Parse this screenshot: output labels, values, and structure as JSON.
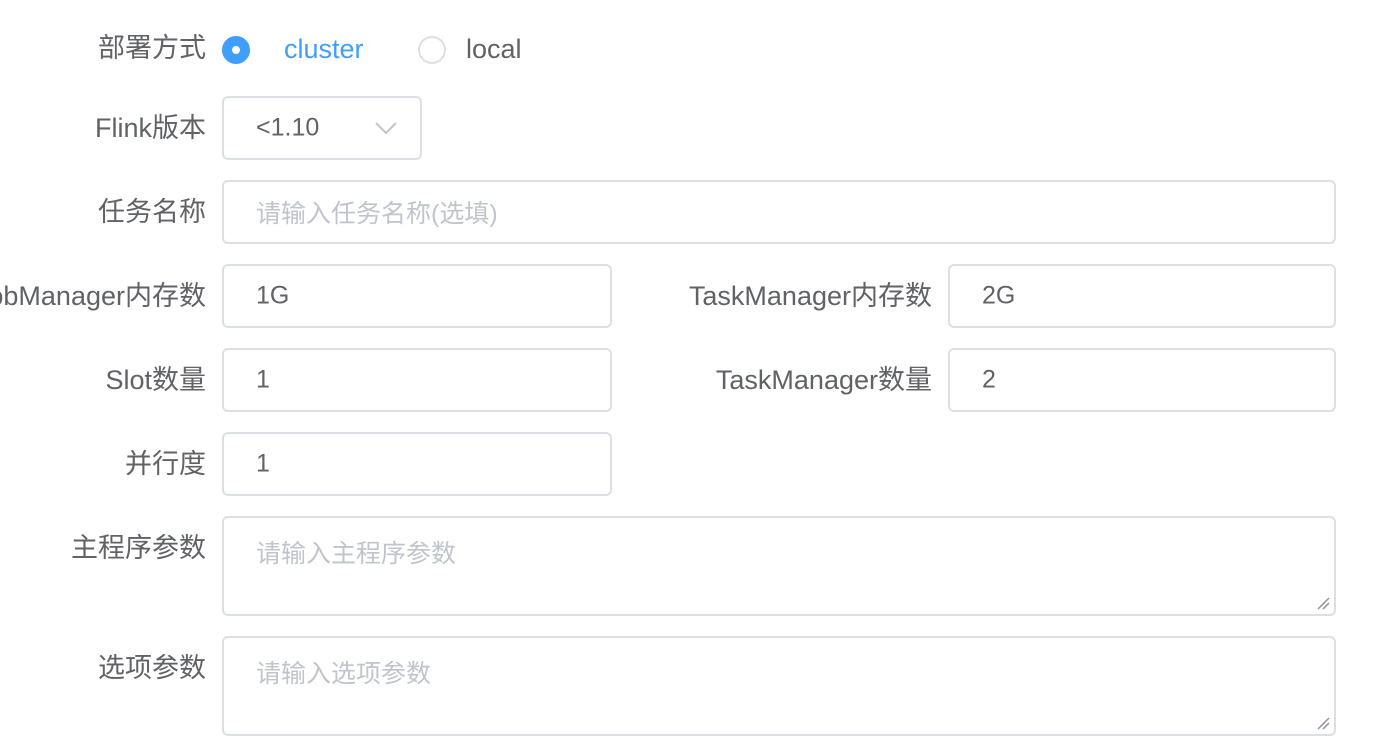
{
  "deploy": {
    "label": "部署方式",
    "options": [
      {
        "label": "cluster",
        "checked": true
      },
      {
        "label": "local",
        "checked": false
      }
    ]
  },
  "flink_version": {
    "label": "Flink版本",
    "value": "<1.10"
  },
  "task_name": {
    "label": "任务名称",
    "placeholder": "请输入任务名称(选填)"
  },
  "job_manager_memory": {
    "label": "JobManager内存数",
    "value": "1G"
  },
  "task_manager_memory": {
    "label": "TaskManager内存数",
    "value": "2G"
  },
  "slot_count": {
    "label": "Slot数量",
    "value": "1"
  },
  "task_manager_count": {
    "label": "TaskManager数量",
    "value": "2"
  },
  "parallelism": {
    "label": "并行度",
    "value": "1"
  },
  "main_args": {
    "label": "主程序参数",
    "placeholder": "请输入主程序参数"
  },
  "option_args": {
    "label": "选项参数",
    "placeholder": "请输入选项参数"
  },
  "colors": {
    "accent": "#409eff",
    "border": "#dcdfe6",
    "text": "#606266",
    "placeholder": "#c0c4cc"
  },
  "icons": {
    "select_arrow": "chevron-down-icon",
    "resize": "resize-handle-icon"
  }
}
